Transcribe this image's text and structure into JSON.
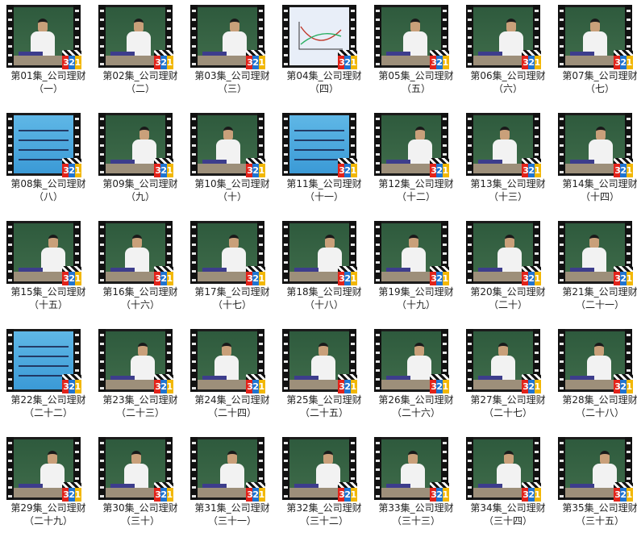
{
  "badge_text": "321",
  "colors": {
    "chalkboard": "#3f6c4a",
    "slide_blue": "#3b9ad6",
    "text": "#222222"
  },
  "episodes": [
    {
      "title": "第01集_公司理财",
      "sub": "（一）",
      "kind": "board"
    },
    {
      "title": "第02集_公司理财",
      "sub": "（二）",
      "kind": "board"
    },
    {
      "title": "第03集_公司理财",
      "sub": "（三）",
      "kind": "board"
    },
    {
      "title": "第04集_公司理财",
      "sub": "（四）",
      "kind": "slide-white"
    },
    {
      "title": "第05集_公司理财",
      "sub": "（五）",
      "kind": "board"
    },
    {
      "title": "第06集_公司理财",
      "sub": "（六）",
      "kind": "board"
    },
    {
      "title": "第07集_公司理财",
      "sub": "（七）",
      "kind": "board"
    },
    {
      "title": "第08集_公司理财",
      "sub": "（八）",
      "kind": "slide"
    },
    {
      "title": "第09集_公司理财",
      "sub": "（九）",
      "kind": "board"
    },
    {
      "title": "第10集_公司理财",
      "sub": "（十）",
      "kind": "board"
    },
    {
      "title": "第11集_公司理财",
      "sub": "（十一）",
      "kind": "slide"
    },
    {
      "title": "第12集_公司理财",
      "sub": "（十二）",
      "kind": "board"
    },
    {
      "title": "第13集_公司理财",
      "sub": "（十三）",
      "kind": "board"
    },
    {
      "title": "第14集_公司理财",
      "sub": "（十四）",
      "kind": "board"
    },
    {
      "title": "第15集_公司理财",
      "sub": "（十五）",
      "kind": "board"
    },
    {
      "title": "第16集_公司理财",
      "sub": "（十六）",
      "kind": "board"
    },
    {
      "title": "第17集_公司理财",
      "sub": "（十七）",
      "kind": "board"
    },
    {
      "title": "第18集_公司理财",
      "sub": "（十八）",
      "kind": "board"
    },
    {
      "title": "第19集_公司理财",
      "sub": "（十九）",
      "kind": "board"
    },
    {
      "title": "第20集_公司理财",
      "sub": "（二十）",
      "kind": "board"
    },
    {
      "title": "第21集_公司理财",
      "sub": "（二十一）",
      "kind": "board"
    },
    {
      "title": "第22集_公司理财",
      "sub": "（二十二）",
      "kind": "slide"
    },
    {
      "title": "第23集_公司理财",
      "sub": "（二十三）",
      "kind": "board"
    },
    {
      "title": "第24集_公司理财",
      "sub": "（二十四）",
      "kind": "board"
    },
    {
      "title": "第25集_公司理财",
      "sub": "（二十五）",
      "kind": "board"
    },
    {
      "title": "第26集_公司理财",
      "sub": "（二十六）",
      "kind": "board"
    },
    {
      "title": "第27集_公司理财",
      "sub": "（二十七）",
      "kind": "board"
    },
    {
      "title": "第28集_公司理财",
      "sub": "（二十八）",
      "kind": "board"
    },
    {
      "title": "第29集_公司理财",
      "sub": "（二十九）",
      "kind": "board"
    },
    {
      "title": "第30集_公司理财",
      "sub": "（三十）",
      "kind": "board"
    },
    {
      "title": "第31集_公司理财",
      "sub": "（三十一）",
      "kind": "board"
    },
    {
      "title": "第32集_公司理财",
      "sub": "（三十二）",
      "kind": "board"
    },
    {
      "title": "第33集_公司理财",
      "sub": "（三十三）",
      "kind": "board"
    },
    {
      "title": "第34集_公司理财",
      "sub": "（三十四）",
      "kind": "board"
    },
    {
      "title": "第35集_公司理财",
      "sub": "（三十五）",
      "kind": "board"
    }
  ]
}
